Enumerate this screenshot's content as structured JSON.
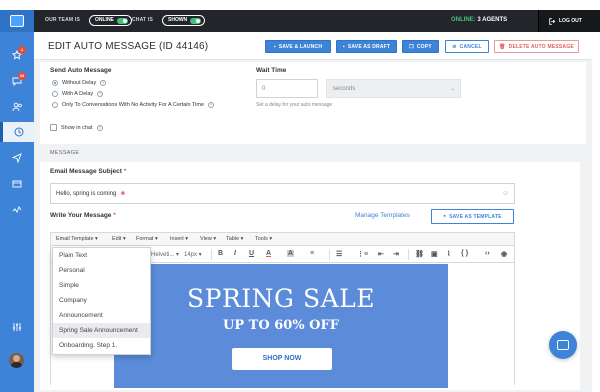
{
  "topbar": {
    "team_label": "OUR TEAM IS",
    "team_status": "ONLINE",
    "chat_label": "CHAT IS",
    "chat_status": "SHOWN",
    "online_prefix": "ONLINE:",
    "online_count": "3 AGENTS",
    "logout": "LOG OUT"
  },
  "sidebar": {
    "items": [
      {
        "icon": "star-icon",
        "badge": "1"
      },
      {
        "icon": "chat-icon",
        "badge": "34"
      },
      {
        "icon": "users-icon",
        "badge": ""
      },
      {
        "icon": "clock-icon",
        "badge": "",
        "active": true
      },
      {
        "icon": "send-icon",
        "badge": ""
      },
      {
        "icon": "window-icon",
        "badge": ""
      },
      {
        "icon": "analytics-icon",
        "badge": ""
      },
      {
        "icon": "settings-sliders-icon",
        "badge": ""
      }
    ]
  },
  "header": {
    "title": "EDIT AUTO MESSAGE (ID 44146)",
    "save_launch": "SAVE & LAUNCH",
    "save_draft": "SAVE AS DRAFT",
    "copy": "COPY",
    "cancel": "CANCEL",
    "delete": "DELETE AUTO MESSAGE"
  },
  "send": {
    "title": "Send Auto Message",
    "options": [
      "Without Delay",
      "With A Delay",
      "Only To Conversations With No Activity For A Certain Time"
    ],
    "selected": 0,
    "show_in_chat": "Show in chat"
  },
  "wait": {
    "title": "Wait Time",
    "value_placeholder": "0",
    "unit": "seconds",
    "hint": "Set a delay for your auto message"
  },
  "message": {
    "section": "MESSAGE",
    "subject_label": "Email Message Subject",
    "subject_value": "Hello, spring is coming",
    "write_label": "Write Your Message",
    "manage_templates": "Manage Templates",
    "save_template": "SAVE AS TEMPLATE"
  },
  "editor_menu": [
    "Email Template",
    "Edit",
    "Format",
    "Insert",
    "View",
    "Table",
    "Tools"
  ],
  "editor_toolbar": {
    "font": "Helveti...",
    "size": "14px"
  },
  "template_options": [
    "Plain Text",
    "Personal",
    "Simple",
    "Company",
    "Announcement",
    "Spring Sale Announcement",
    "Onboarding. Step 1."
  ],
  "template_hover": 5,
  "banner": {
    "headline": "SPRING SALE",
    "subhead": "UP TO 60% OFF",
    "cta": "SHOP NOW"
  },
  "colors": {
    "accent": "#3d84d8",
    "online": "#47c07a",
    "danger": "#e06060",
    "banner": "#5b8bd9"
  }
}
